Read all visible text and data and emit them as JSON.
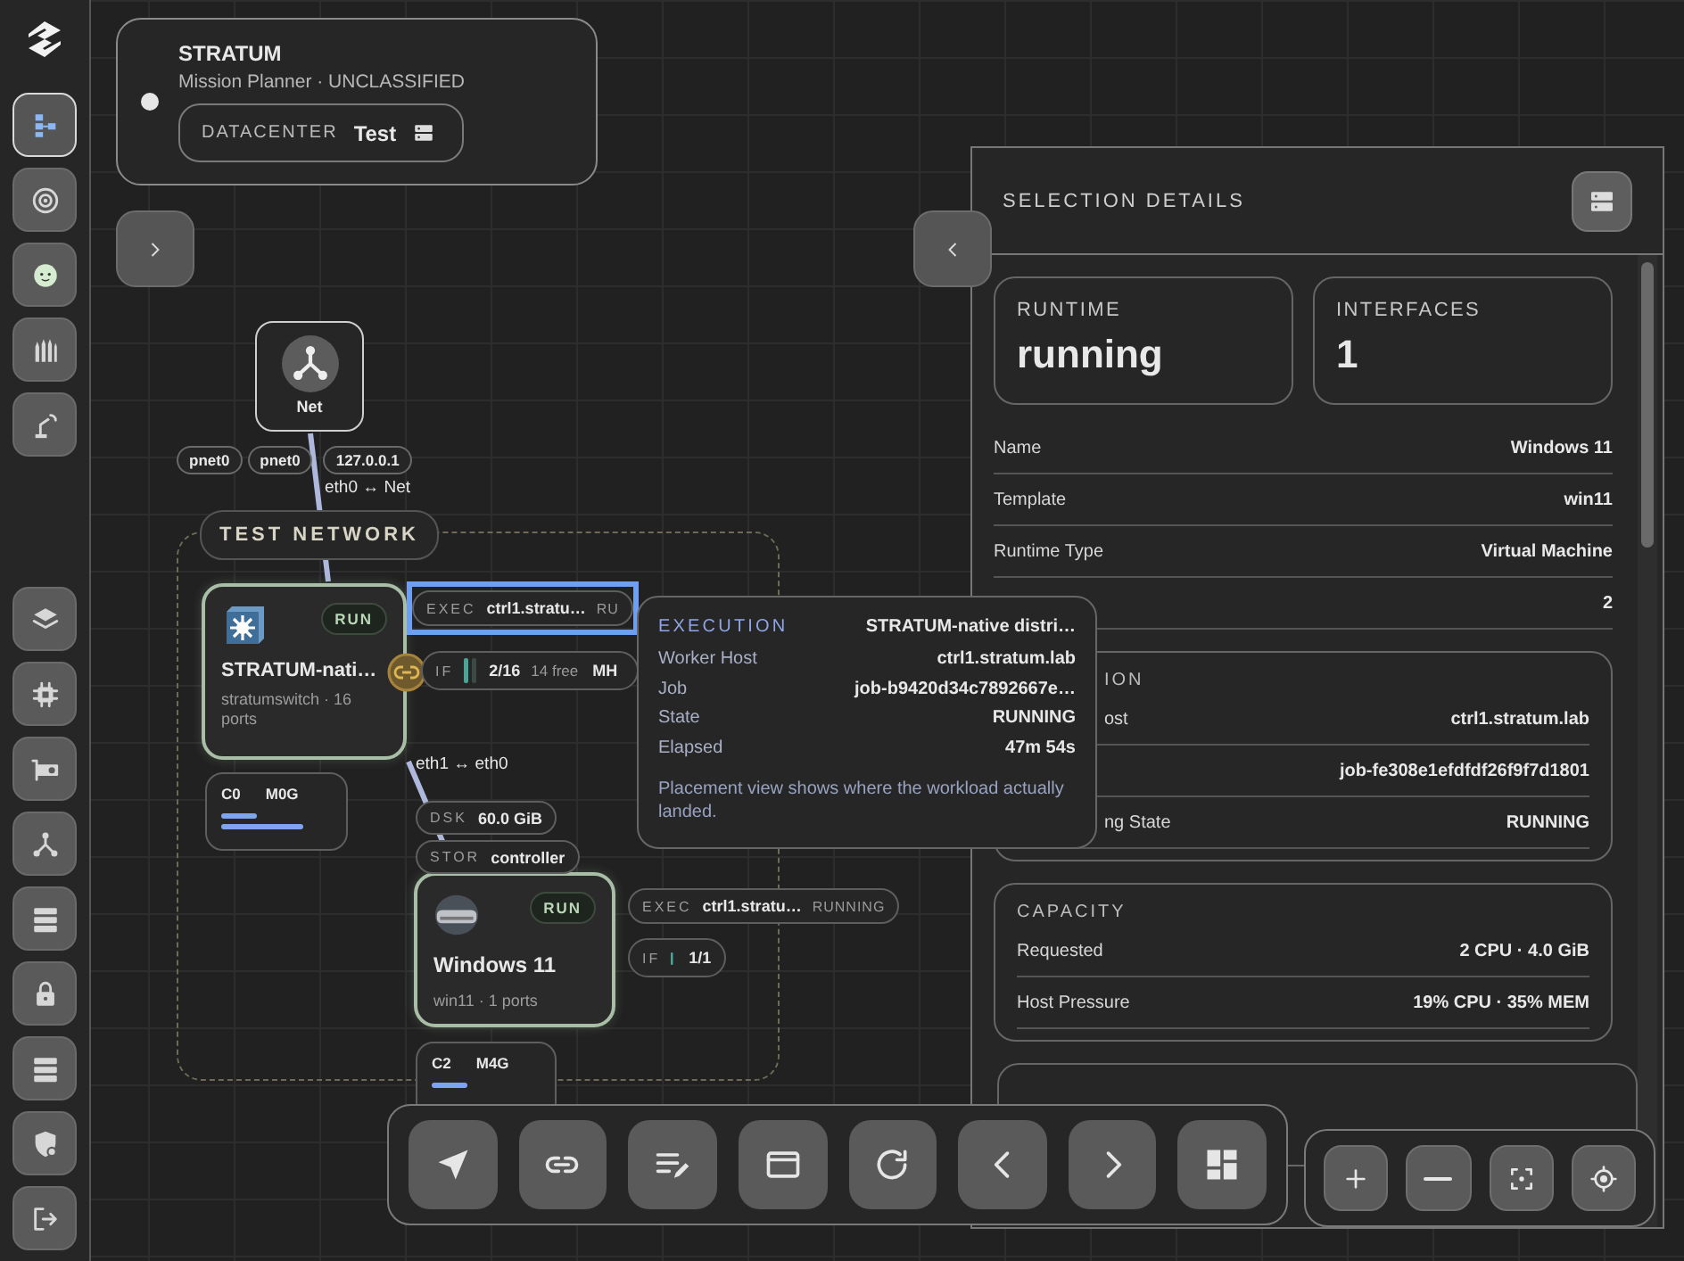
{
  "rail": {
    "top": [
      {
        "kind": "flow",
        "selected": true
      },
      {
        "kind": "target",
        "selected": false
      },
      {
        "kind": "mascot",
        "selected": false
      },
      {
        "kind": "bullets",
        "selected": false
      },
      {
        "kind": "robotarm",
        "selected": false
      }
    ],
    "bottom": [
      {
        "kind": "layers",
        "selected": false
      },
      {
        "kind": "chip",
        "selected": false
      },
      {
        "kind": "gpu",
        "selected": false
      },
      {
        "kind": "network",
        "selected": false
      },
      {
        "kind": "server",
        "selected": false
      },
      {
        "kind": "lock",
        "selected": false
      },
      {
        "kind": "server",
        "selected": false
      },
      {
        "kind": "shield",
        "selected": false
      },
      {
        "kind": "logout",
        "selected": false
      }
    ]
  },
  "header": {
    "title": "STRATUM",
    "subtitle": "Mission Planner · UNCLASSIFIED",
    "datacenter": {
      "label": "DATACENTER",
      "value": "Test"
    }
  },
  "canvas": {
    "net_node": {
      "label": "Net"
    },
    "net_pills": [
      "pnet0",
      "pnet0",
      "127.0.0.1"
    ],
    "links": [
      "eth0 ↔ Net",
      "eth1 ↔ eth0"
    ],
    "group": {
      "label": "TEST NETWORK"
    },
    "nodes": [
      {
        "kind": "switch",
        "name": "STRATUM-nati…",
        "meta": "stratumswitch · 16 ports",
        "status": "RUN"
      },
      {
        "kind": "vm",
        "name": "Windows 11",
        "meta": "win11 · 1 ports",
        "status": "RUN"
      }
    ],
    "exec_pills": [
      {
        "label": "EXEC",
        "host": "ctrl1.stratu…",
        "state": "RU",
        "highlighted": true
      },
      {
        "label": "EXEC",
        "host": "ctrl1.stratu…",
        "state": "RUNNING",
        "highlighted": false
      }
    ],
    "if_pills": [
      {
        "label": "IF",
        "value": "2/16",
        "free": "14 free",
        "tag": "MH"
      },
      {
        "label": "IF",
        "value": "1/1"
      }
    ],
    "storage_pills": [
      {
        "label": "DSK",
        "value": "60.0 GiB"
      },
      {
        "label": "STOR",
        "value": "controller"
      }
    ],
    "resources": [
      {
        "cpu": "C0",
        "mem": "M0G"
      },
      {
        "cpu": "C2",
        "mem": "M4G"
      }
    ]
  },
  "tooltip": {
    "title": "EXECUTION",
    "subject": "STRATUM-native distri…",
    "rows": [
      {
        "label": "Worker Host",
        "value": "ctrl1.stratum.lab"
      },
      {
        "label": "Job",
        "value": "job-b9420d34c7892667e…"
      },
      {
        "label": "State",
        "value": "RUNNING"
      },
      {
        "label": "Elapsed",
        "value": "47m 54s"
      }
    ],
    "note": "Placement view shows where the workload actually landed."
  },
  "panel": {
    "title": "SELECTION DETAILS",
    "stats": [
      {
        "label": "RUNTIME",
        "value": "running"
      },
      {
        "label": "INTERFACES",
        "value": "1"
      }
    ],
    "rows": [
      {
        "label": "Name",
        "value": "Windows 11"
      },
      {
        "label": "Template",
        "value": "win11"
      },
      {
        "label": "Runtime Type",
        "value": "Virtual Machine"
      },
      {
        "value": "2"
      }
    ],
    "sections": [
      {
        "title": "ION",
        "rows": [
          {
            "label": "ost",
            "value": "ctrl1.stratum.lab"
          },
          {
            "value": "job-fe308e1efdfdf26f9f7d1801"
          },
          {
            "label": "ng State",
            "value": "RUNNING"
          }
        ]
      },
      {
        "title": "CAPACITY",
        "rows": [
          {
            "label": "Requested",
            "value": "2 CPU · 4.0 GiB"
          },
          {
            "label": "Host Pressure",
            "value": "19% CPU · 35% MEM"
          }
        ]
      }
    ]
  },
  "toolbar": [
    {
      "kind": "pointer"
    },
    {
      "kind": "link"
    },
    {
      "kind": "edit"
    },
    {
      "kind": "window"
    },
    {
      "kind": "refresh"
    },
    {
      "kind": "prev"
    },
    {
      "kind": "next"
    },
    {
      "kind": "dashboard"
    }
  ],
  "zoom": [
    {
      "kind": "plus"
    },
    {
      "kind": "minus"
    },
    {
      "kind": "fit"
    },
    {
      "kind": "locate"
    }
  ]
}
